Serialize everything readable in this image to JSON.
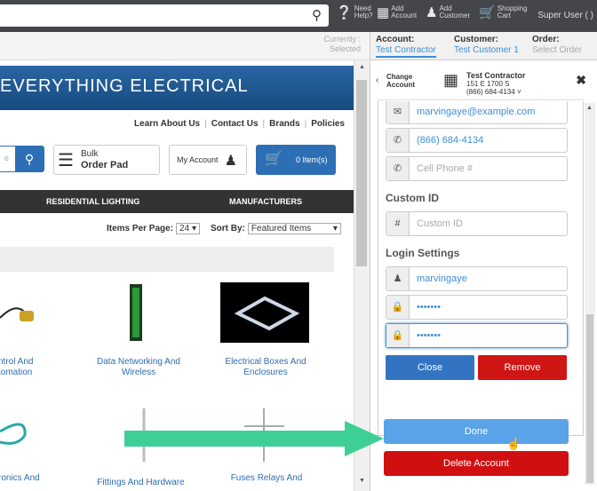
{
  "topbar": {
    "search_icon": "search-icon",
    "help_l1": "Need",
    "help_l2": "Help?",
    "add_account_l1": "Add",
    "add_account_l2": "Account",
    "add_customer_l1": "Add",
    "add_customer_l2": "Customer",
    "cart_l1": "Shopping",
    "cart_l2": "Cart",
    "user": "Super User ( )"
  },
  "context": {
    "currently_l1": "Currently",
    "currently_l2": "Selected"
  },
  "breadcrumbs": [
    {
      "label": "Account:",
      "value": "Test Contractor"
    },
    {
      "label": "Customer:",
      "value": "Test Customer 1"
    },
    {
      "label": "Order:",
      "value": "Select Order"
    }
  ],
  "site": {
    "banner": "EVERYTHING ELECTRICAL",
    "links": [
      "Learn About Us",
      "Contact Us",
      "Brands",
      "Policies"
    ],
    "search_placeholder": "e",
    "bulk_l1": "Bulk",
    "bulk_l2": "Order Pad",
    "my_account": "My Account",
    "cart": "0 Item(s)",
    "nav": [
      "RESIDENTIAL LIGHTING",
      "MANUFACTURERS"
    ],
    "items_per_page_label": "Items Per Page:",
    "items_per_page": "24",
    "sort_label": "Sort By:",
    "sort_value": "Featured Items",
    "products": [
      {
        "l1": "ntrol And",
        "l2": "tomation"
      },
      {
        "l1": "Data Networking And",
        "l2": "Wireless"
      },
      {
        "l1": "Electrical Boxes And",
        "l2": "Enclosures"
      },
      {
        "l1": "ronics And",
        "l2": ""
      },
      {
        "l1": "Fittings And Hardware",
        "l2": ""
      },
      {
        "l1": "Fuses Relays And",
        "l2": ""
      }
    ]
  },
  "panel": {
    "change_l1": "Change",
    "change_l2": "Account",
    "account_name": "Test Contractor",
    "account_addr": "151 E 1700 S",
    "account_phone": "(866) 684-4134",
    "email": "marvingaye@example.com",
    "phone": "(866) 684-4134",
    "cell_placeholder": "Cell Phone #",
    "custom_id_heading": "Custom ID",
    "custom_id_placeholder": "Custom ID",
    "login_heading": "Login Settings",
    "username": "marvingaye",
    "password1": "•••••••",
    "password2": "•••••••",
    "close": "Close",
    "remove": "Remove",
    "done": "Done",
    "delete": "Delete Account"
  },
  "colors": {
    "topbar": "#45464a",
    "accent": "#3c8fd6",
    "danger": "#d01515",
    "arrow": "#3ecf97"
  }
}
